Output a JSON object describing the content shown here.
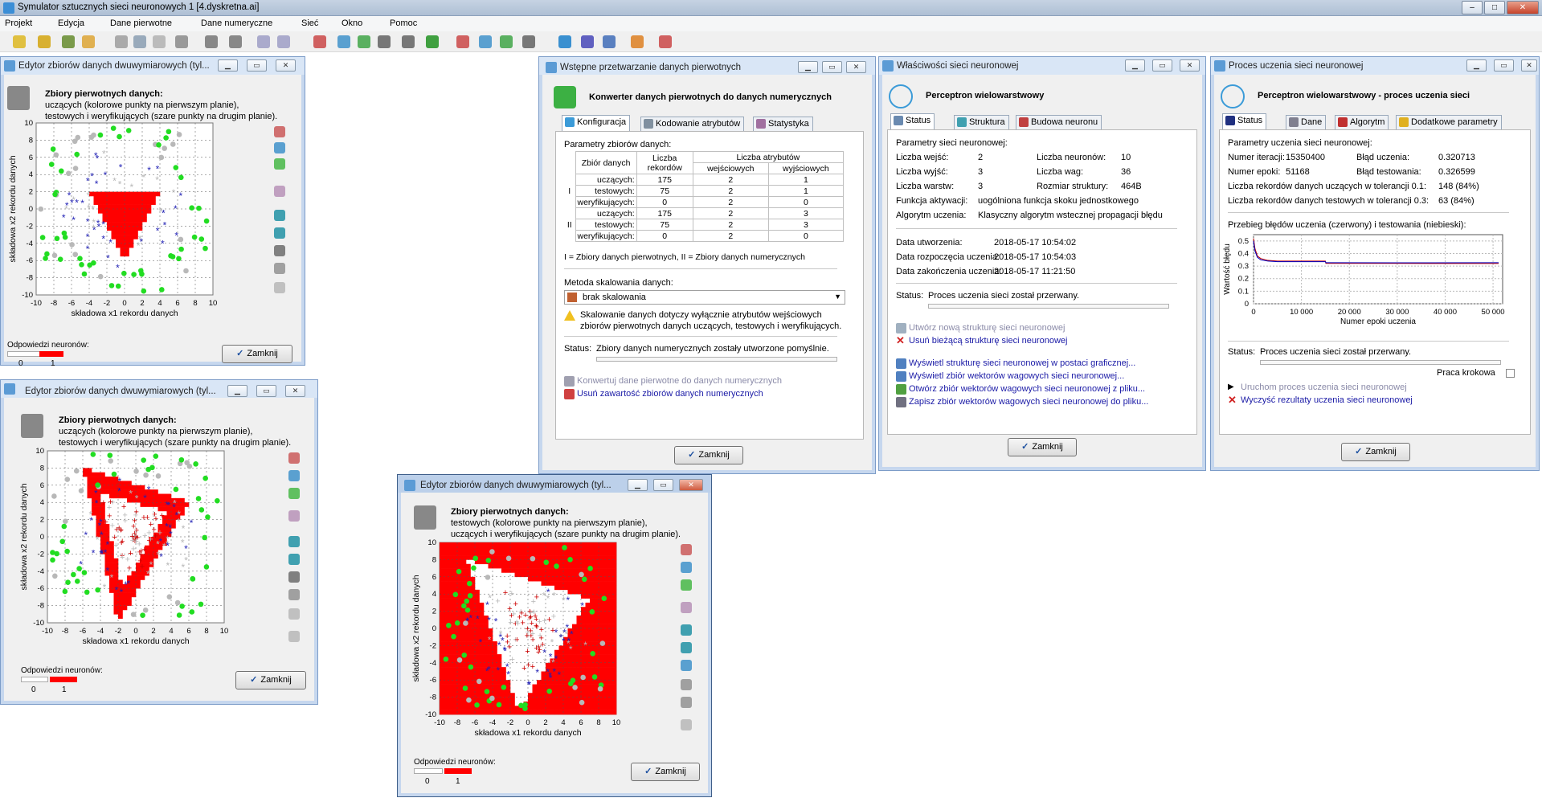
{
  "app": {
    "title": "Symulator sztucznych sieci neuronowych 1 [4.dyskretna.ai]",
    "caption_buttons": [
      "–",
      "□",
      "✕"
    ]
  },
  "menu": [
    "Projekt",
    "Edycja",
    "Dane pierwotne",
    "Dane numeryczne",
    "Sieć",
    "Okno",
    "Pomoc"
  ],
  "editor_common": {
    "heading": "Zbiory pierwotnych danych:",
    "desc1": "uczących (kolorowe punkty na pierwszym planie),",
    "desc2": "testowych i weryfikujących (szare punkty na drugim planie).",
    "desc1_b": "testowych (kolorowe punkty na pierwszym planie),",
    "desc2_b": "uczących i weryfikujących (szare punkty na drugim planie).",
    "xlabel": "składowa x1 rekordu danych",
    "ylabel": "składowa x2 rekordu danych",
    "xticks": [
      "-10",
      "-8",
      "-6",
      "-4",
      "-2",
      "0",
      "2",
      "4",
      "6",
      "8",
      "10"
    ],
    "yticks": [
      "10",
      "8",
      "6",
      "4",
      "2",
      "0",
      "-2",
      "-4",
      "-6",
      "-8",
      "-10"
    ],
    "legend_title": "Odpowiedzi neuronów:",
    "legend_0": "0",
    "legend_1": "1",
    "close": "Zamknij"
  },
  "editor1": {
    "title": "Edytor zbiorów danych dwuwymiarowych (tyl..."
  },
  "editor2": {
    "title": "Edytor zbiorów danych dwuwymiarowych (tyl..."
  },
  "editor3": {
    "title": "Edytor zbiorów danych dwuwymiarowych (tyl..."
  },
  "preproc": {
    "title": "Wstępne przetwarzanie danych pierwotnych",
    "header": "Konwerter danych pierwotnych do danych numerycznych",
    "tabs": [
      "Konfiguracja",
      "Kodowanie atrybutów",
      "Statystyka"
    ],
    "params_label": "Parametry zbiorów danych:",
    "table_head": [
      "Zbiór danych",
      "Liczba rekordów",
      "Liczba atrybutów",
      "wejściowych",
      "wyjściowych"
    ],
    "rows": [
      {
        "g": "I",
        "name": "uczących:",
        "n": "175",
        "in": "2",
        "out": "1"
      },
      {
        "g": "",
        "name": "testowych:",
        "n": "75",
        "in": "2",
        "out": "1"
      },
      {
        "g": "",
        "name": "weryfikujących:",
        "n": "0",
        "in": "2",
        "out": "0"
      },
      {
        "g": "II",
        "name": "uczących:",
        "n": "175",
        "in": "2",
        "out": "3"
      },
      {
        "g": "",
        "name": "testowych:",
        "n": "75",
        "in": "2",
        "out": "3"
      },
      {
        "g": "",
        "name": "weryfikujących:",
        "n": "0",
        "in": "2",
        "out": "0"
      }
    ],
    "legend": "I = Zbiory danych pierwotnych, II = Zbiory danych numerycznych",
    "scaling_label": "Metoda skalowania danych:",
    "scaling_value": "brak skalowania",
    "warn1": "Skalowanie danych dotyczy wyłącznie atrybutów wejściowych",
    "warn2": "zbiorów pierwotnych danych uczących, testowych i weryfikujących.",
    "status_label": "Status:",
    "status_value": "Zbiory danych numerycznych zostały utworzone pomyślnie.",
    "link1": "Konwertuj dane pierwotne do danych numerycznych",
    "link2": "Usuń zawartość zbiorów danych numerycznych",
    "close": "Zamknij"
  },
  "props": {
    "title": "Właściwości sieci neuronowej",
    "header": "Perceptron wielowarstwowy",
    "tabs": [
      "Status",
      "Struktura",
      "Budowa neuronu"
    ],
    "params_label": "Parametry sieci neuronowej:",
    "l_inputs": "Liczba wejść:",
    "v_inputs": "2",
    "l_outputs": "Liczba wyjść:",
    "v_outputs": "3",
    "l_layers": "Liczba warstw:",
    "v_layers": "3",
    "l_neurons": "Liczba neuronów:",
    "v_neurons": "10",
    "l_weights": "Liczba wag:",
    "v_weights": "36",
    "l_size": "Rozmiar struktury:",
    "v_size": "464B",
    "l_act": "Funkcja aktywacji:",
    "v_act": "uogólniona funkcja skoku jednostkowego",
    "l_alg": "Algorytm uczenia:",
    "v_alg": "Klasyczny algorytm wstecznej propagacji błędu",
    "l_created": "Data utworzenia:",
    "v_created": "2018-05-17 10:54:02",
    "l_started": "Data rozpoczęcia uczenia:",
    "v_started": "2018-05-17 10:54:03",
    "l_ended": "Data zakończenia uczenia:",
    "v_ended": "2018-05-17 11:21:50",
    "status_label": "Status:",
    "status_value": "Proces uczenia sieci został przerwany.",
    "link_create": "Utwórz nową strukturę sieci neuronowej",
    "link_delete": "Usuń bieżącą strukturę sieci neuronowej",
    "link_show": "Wyświetl strukturę sieci neuronowej w postaci graficznej...",
    "link_weights": "Wyświetl zbiór wektorów wagowych sieci neuronowej...",
    "link_open": "Otwórz zbiór wektorów wagowych sieci neuronowej z pliku...",
    "link_save": "Zapisz zbiór wektorów wagowych sieci neuronowej do pliku...",
    "close": "Zamknij"
  },
  "training": {
    "title": "Proces uczenia sieci neuronowej",
    "header": "Perceptron wielowarstwowy - proces uczenia sieci",
    "tabs": [
      "Status",
      "Dane",
      "Algorytm",
      "Dodatkowe parametry"
    ],
    "params_label": "Parametry uczenia sieci neuronowej:",
    "l_iter": "Numer iteracji:",
    "v_iter": "15350400",
    "l_epoch": "Numer epoki:",
    "v_epoch": "51168",
    "l_err_train": "Błąd uczenia:",
    "v_err_train": "0.320713",
    "l_err_test": "Błąd testowania:",
    "v_err_test": "0.326599",
    "l_tol_train": "Liczba rekordów danych uczących w tolerancji 0.1:",
    "v_tol_train": "148 (84%)",
    "l_tol_test": "Liczba rekordów danych testowych w tolerancji 0.3:",
    "v_tol_test": "63 (84%)",
    "chart_title": "Przebieg błędów uczenia (czerwony) i testowania (niebieski):",
    "status_label": "Status:",
    "status_value": "Proces uczenia sieci został przerwany.",
    "step_label": "Praca krokowa",
    "link_run": "Uruchom proces uczenia sieci neuronowej",
    "link_clear": "Wyczyść rezultaty uczenia sieci neuronowej",
    "close": "Zamknij"
  },
  "chart_data": {
    "type": "line",
    "xlabel": "Numer epoki uczenia",
    "ylabel": "Wartość błędu",
    "xlim": [
      0,
      52000
    ],
    "ylim": [
      0,
      0.55
    ],
    "xticks": [
      "0",
      "10 000",
      "20 000",
      "30 000",
      "40 000",
      "50 000"
    ],
    "yticks": [
      "0",
      "0.1",
      "0.2",
      "0.3",
      "0.4",
      "0.5"
    ],
    "series": [
      {
        "color": "#c00000",
        "x": [
          0,
          300,
          800,
          1500,
          3000,
          5000,
          15000,
          15100,
          30000,
          51168
        ],
        "y": [
          0.52,
          0.44,
          0.38,
          0.36,
          0.345,
          0.34,
          0.34,
          0.321,
          0.321,
          0.3207
        ]
      },
      {
        "color": "#0000c0",
        "x": [
          0,
          300,
          800,
          1500,
          3000,
          5000,
          15000,
          15100,
          30000,
          51168
        ],
        "y": [
          0.5,
          0.42,
          0.37,
          0.35,
          0.34,
          0.335,
          0.335,
          0.327,
          0.326,
          0.3266
        ]
      }
    ]
  },
  "colors": {
    "class_red": "#ff0000",
    "point_green": "#22dd22",
    "point_blue": "#1f1fb4",
    "point_gray": "#b8b8b8",
    "link": "#1a1aa6"
  }
}
